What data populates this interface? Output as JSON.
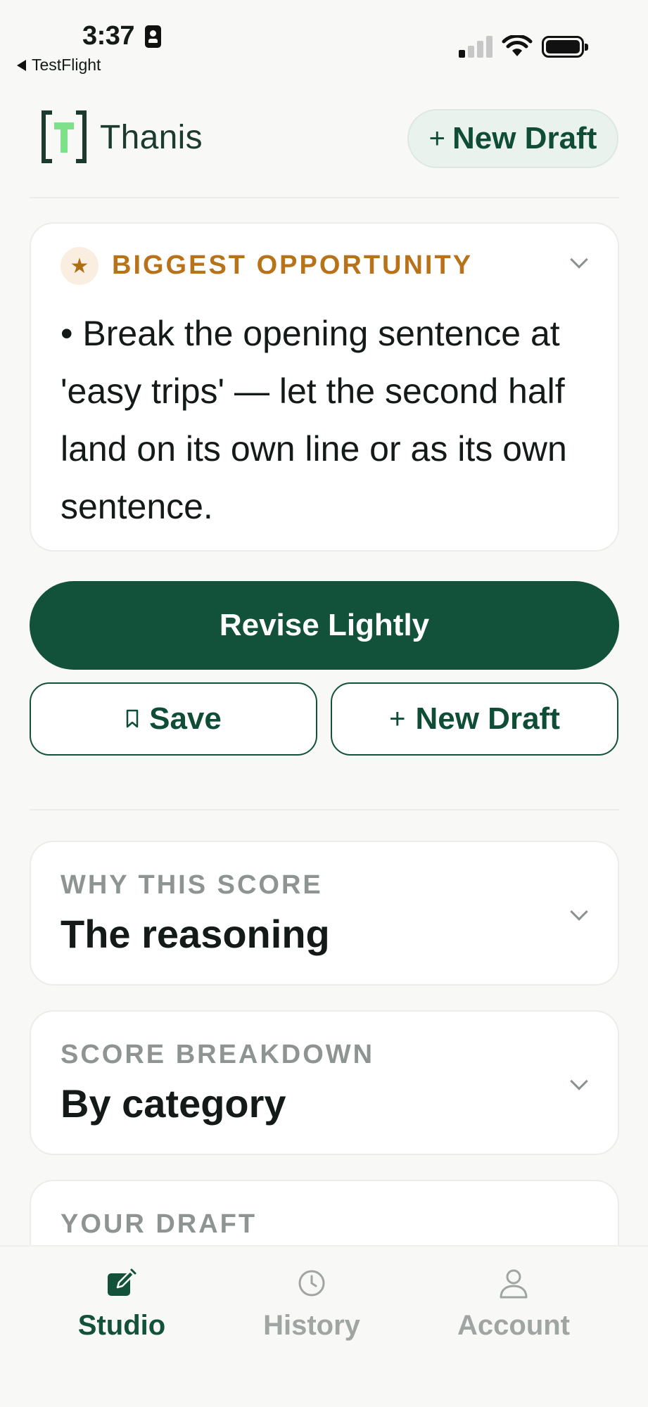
{
  "status_bar": {
    "time": "3:37",
    "back_label": "TestFlight"
  },
  "header": {
    "app_name": "Thanis",
    "logo_letter": "T",
    "new_draft_label": "New Draft"
  },
  "opportunity": {
    "label": "BIGGEST OPPORTUNITY",
    "text": "• Break the opening sentence at 'easy trips' — let the second half land on its own line or as its own sentence."
  },
  "actions": {
    "revise_label": "Revise Lightly",
    "save_label": "Save",
    "new_draft_label": "New Draft"
  },
  "sections": [
    {
      "eyebrow": "WHY THIS SCORE",
      "title": "The reasoning"
    },
    {
      "eyebrow": "SCORE BREAKDOWN",
      "title": "By category"
    },
    {
      "eyebrow": "YOUR DRAFT"
    }
  ],
  "tabs": [
    {
      "label": "Studio",
      "icon": "pencil-square-icon",
      "active": true
    },
    {
      "label": "History",
      "icon": "clock-icon",
      "active": false
    },
    {
      "label": "Account",
      "icon": "person-icon",
      "active": false
    }
  ],
  "colors": {
    "brand_green": "#12513a",
    "accent_amber": "#b8731a",
    "logo_mint": "#7fe08a",
    "background": "#f8f8f6"
  }
}
